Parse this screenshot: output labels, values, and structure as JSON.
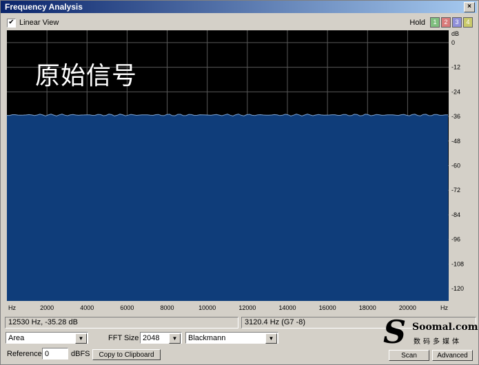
{
  "window": {
    "title": "Frequency Analysis",
    "close": "×"
  },
  "toolbar": {
    "linear_view_label": "Linear View",
    "linear_view_checked": "✔",
    "hold_label": "Hold",
    "hold_buttons": [
      {
        "label": "1",
        "color": "#7fbf7f"
      },
      {
        "label": "2",
        "color": "#d97b7b"
      },
      {
        "label": "3",
        "color": "#8f8fd9"
      },
      {
        "label": "4",
        "color": "#c9c96a"
      }
    ]
  },
  "overlay_text": "原始信号",
  "chart_data": {
    "type": "area",
    "x_unit": "Hz",
    "y_unit": "dB",
    "x_ticks": [
      2000,
      4000,
      6000,
      8000,
      10000,
      12000,
      14000,
      16000,
      18000,
      20000
    ],
    "y_ticks": [
      0,
      -12,
      -24,
      -36,
      -48,
      -60,
      -72,
      -84,
      -96,
      -108,
      -120
    ],
    "xlim": [
      0,
      22050
    ],
    "ylim": [
      -126,
      6
    ],
    "series": [
      {
        "level": -35.3,
        "fill": "#0f3d7a",
        "stroke": "#7fa6d6"
      }
    ],
    "grid": true
  },
  "status": {
    "cursor": "12530 Hz, -35.28 dB",
    "peak": "3120.4 Hz (G7 -8)"
  },
  "controls": {
    "graph_type": "Area",
    "fft_size_label": "FFT Size",
    "fft_size": "2048",
    "window_fn": "Blackmann",
    "reference_label": "Reference",
    "reference_value": "0",
    "reference_unit": "dBFS",
    "copy_button": "Copy to Clipboard",
    "scan_button": "Scan",
    "advanced_button": "Advanced",
    "dropdown_arrow": "▼"
  },
  "logo": {
    "mark": "S",
    "name": "Soomal.com",
    "sub": "数码多媒体"
  }
}
